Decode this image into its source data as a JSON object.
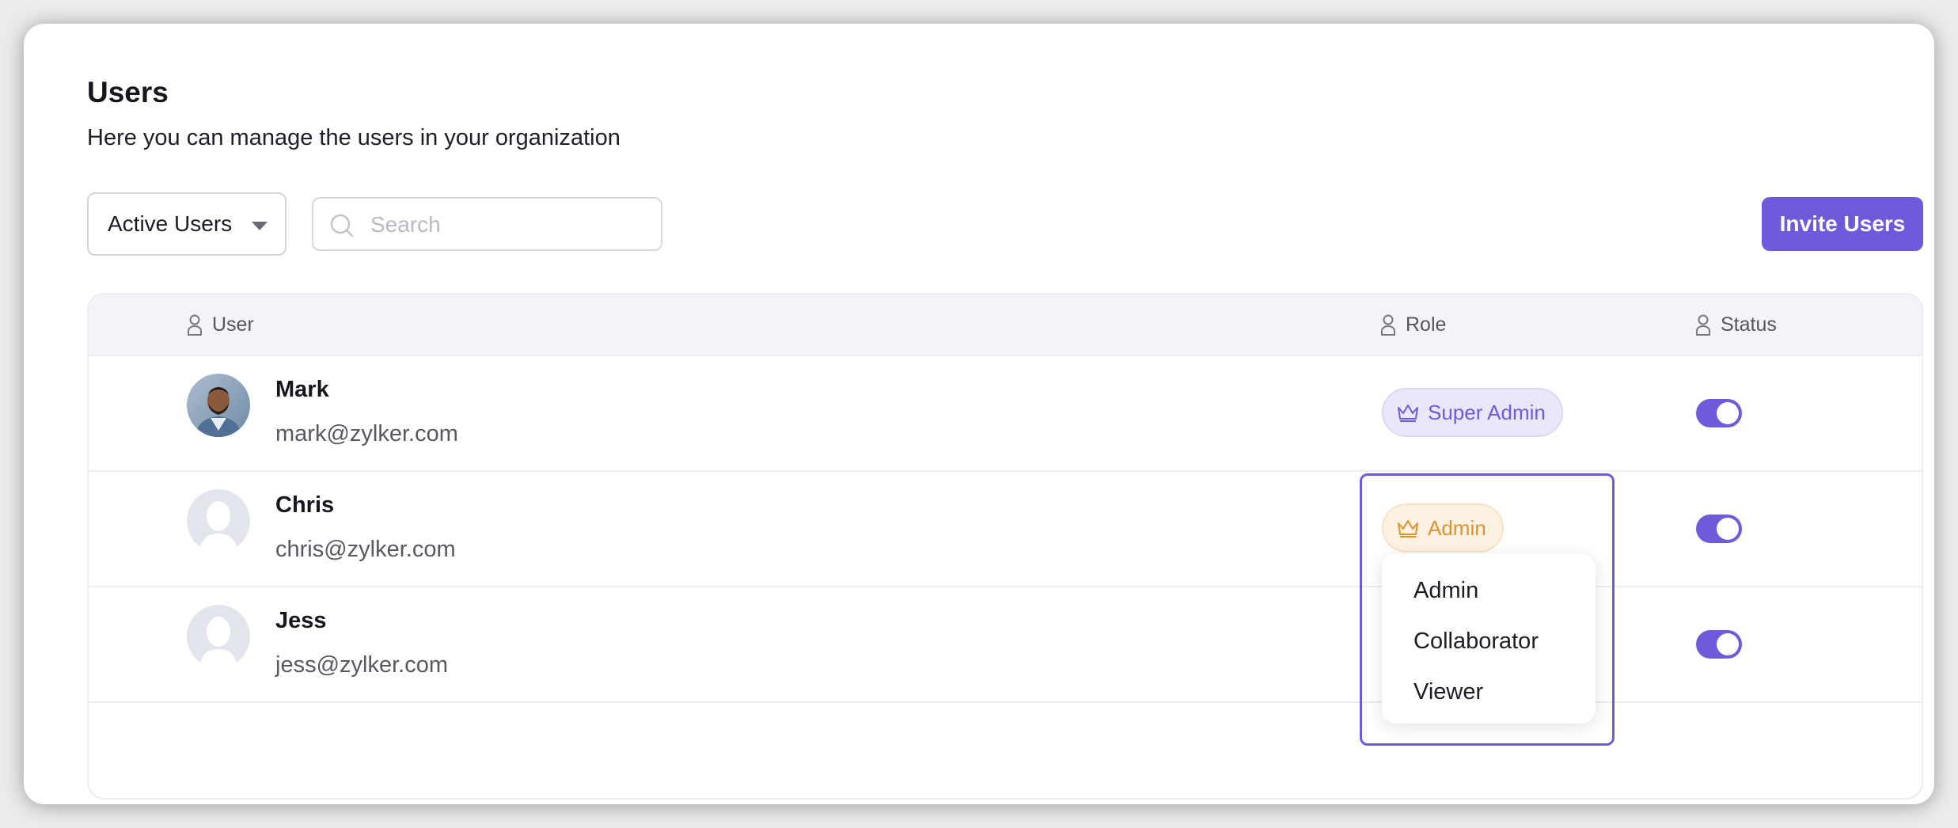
{
  "header": {
    "title": "Users",
    "subtitle": "Here you can manage the users in your organization"
  },
  "toolbar": {
    "filter_label": "Active Users",
    "search_placeholder": "Search",
    "search_value": "",
    "invite_label": "Invite Users"
  },
  "table": {
    "columns": {
      "user": "User",
      "role": "Role",
      "status": "Status"
    },
    "rows": [
      {
        "name": "Mark",
        "email": "mark@zylker.com",
        "role": "Super Admin",
        "avatar": "photo",
        "status_on": true
      },
      {
        "name": "Chris",
        "email": "chris@zylker.com",
        "role": "Admin",
        "avatar": "placeholder",
        "status_on": true
      },
      {
        "name": "Jess",
        "email": "jess@zylker.com",
        "role": "",
        "avatar": "placeholder",
        "status_on": true
      }
    ]
  },
  "role_menu": {
    "options": [
      "Admin",
      "Collaborator",
      "Viewer"
    ]
  },
  "colors": {
    "accent": "#6d5bdc",
    "super_admin_bg": "#ebe7fb",
    "admin_text": "#e1922e",
    "admin_bg": "#fdf1e1"
  },
  "icons": {
    "column_header": "person-icon",
    "role_badge": "crown-icon",
    "search": "search-icon",
    "filter": "caret-down-icon"
  }
}
